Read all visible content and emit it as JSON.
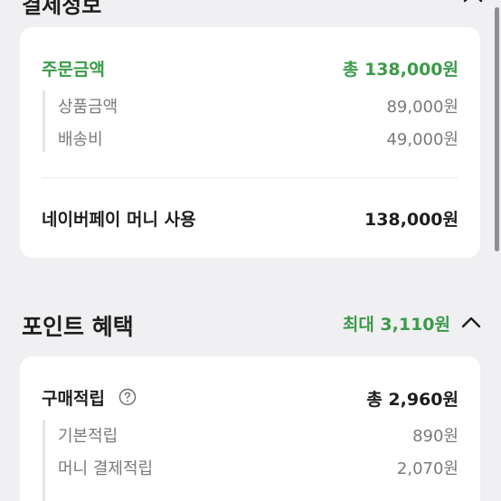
{
  "payment_section": {
    "title": "결제정보"
  },
  "order_card": {
    "order_amount_label": "주문금액",
    "order_amount_value": "총 138,000원",
    "items": [
      {
        "label": "상품금액",
        "value": "89,000원"
      },
      {
        "label": "배송비",
        "value": "49,000원"
      }
    ],
    "naverpay_label": "네이버페이 머니 사용",
    "naverpay_value": "138,000원"
  },
  "points_section": {
    "title": "포인트 혜택",
    "max_label": "최대 3,110원"
  },
  "points_card": {
    "purchase_label": "구매적립",
    "purchase_value": "총 2,960원",
    "items": [
      {
        "label": "기본적립",
        "value": "890원"
      },
      {
        "label": "머니 결제적립",
        "value": "2,070원"
      }
    ]
  },
  "icons": {
    "collapse": "chevron-up-icon",
    "help": "question-circle-icon"
  },
  "colors": {
    "accent_green": "#3c9a4a",
    "background": "#f0f0f2",
    "card": "#ffffff"
  }
}
